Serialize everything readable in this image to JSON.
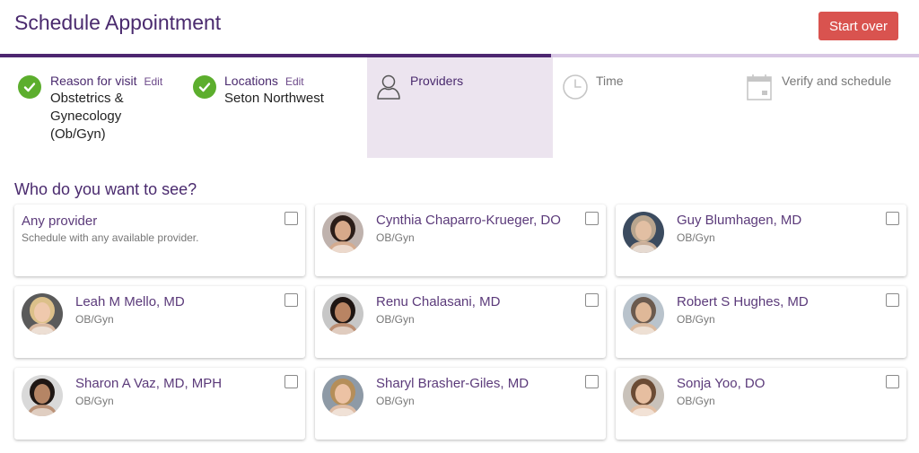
{
  "header": {
    "title": "Schedule Appointment",
    "start_over_label": "Start over"
  },
  "progress": {
    "completed_fraction": 0.6
  },
  "steps": [
    {
      "label": "Reason for visit",
      "edit": "Edit",
      "value_lines": [
        "Obstetrics &",
        "Gynecology",
        "(Ob/Gyn)"
      ],
      "status": "done",
      "icon": "check-circle-icon"
    },
    {
      "label": "Locations",
      "edit": "Edit",
      "value_lines": [
        "Seton Northwest"
      ],
      "status": "done",
      "icon": "check-circle-icon"
    },
    {
      "label": "Providers",
      "status": "active",
      "icon": "person-icon"
    },
    {
      "label": "Time",
      "status": "pending",
      "icon": "clock-icon"
    },
    {
      "label": "Verify and schedule",
      "status": "pending",
      "icon": "calendar-icon"
    }
  ],
  "section_title": "Who do you want to see?",
  "providers": [
    {
      "name": "Any provider",
      "specialty": "Schedule with any available provider.",
      "avatar": false,
      "checked": false
    },
    {
      "name": "Cynthia Chaparro-Krueger, DO",
      "specialty": "OB/Gyn",
      "avatar": true,
      "hair": "#2b1d18",
      "skin": "#d7a98a",
      "bg": "#bfb2ad",
      "checked": false
    },
    {
      "name": "Guy Blumhagen, MD",
      "specialty": "OB/Gyn",
      "avatar": true,
      "hair": "#b9a58e",
      "skin": "#e2bfa3",
      "bg": "#3b4b5f",
      "checked": false
    },
    {
      "name": "Leah M Mello, MD",
      "specialty": "OB/Gyn",
      "avatar": true,
      "hair": "#dcc08a",
      "skin": "#efc9ad",
      "bg": "#5a5a5a",
      "checked": false
    },
    {
      "name": "Renu Chalasani, MD",
      "specialty": "OB/Gyn",
      "avatar": true,
      "hair": "#1e1512",
      "skin": "#b98463",
      "bg": "#c7c7c7",
      "checked": false
    },
    {
      "name": "Robert S Hughes, MD",
      "specialty": "OB/Gyn",
      "avatar": true,
      "hair": "#6b5a4e",
      "skin": "#dfb898",
      "bg": "#b9c3cc",
      "checked": false
    },
    {
      "name": "Sharon A Vaz, MD, MPH",
      "specialty": "OB/Gyn",
      "avatar": true,
      "hair": "#1f1714",
      "skin": "#b58565",
      "bg": "#d9d9d9",
      "checked": false
    },
    {
      "name": "Sharyl Brasher-Giles, MD",
      "specialty": "OB/Gyn",
      "avatar": true,
      "hair": "#b58e59",
      "skin": "#ecc2a4",
      "bg": "#8e9aa6",
      "checked": false
    },
    {
      "name": "Sonja Yoo, DO",
      "specialty": "OB/Gyn",
      "avatar": true,
      "hair": "#6b4b34",
      "skin": "#e6bea0",
      "bg": "#c9c2ba",
      "checked": false
    }
  ],
  "colors": {
    "brand": "#4d2670",
    "accent_text": "#5b3a7a",
    "done": "#5cae2d",
    "button": "#d9534f",
    "active_step_bg": "#ece4ef"
  }
}
